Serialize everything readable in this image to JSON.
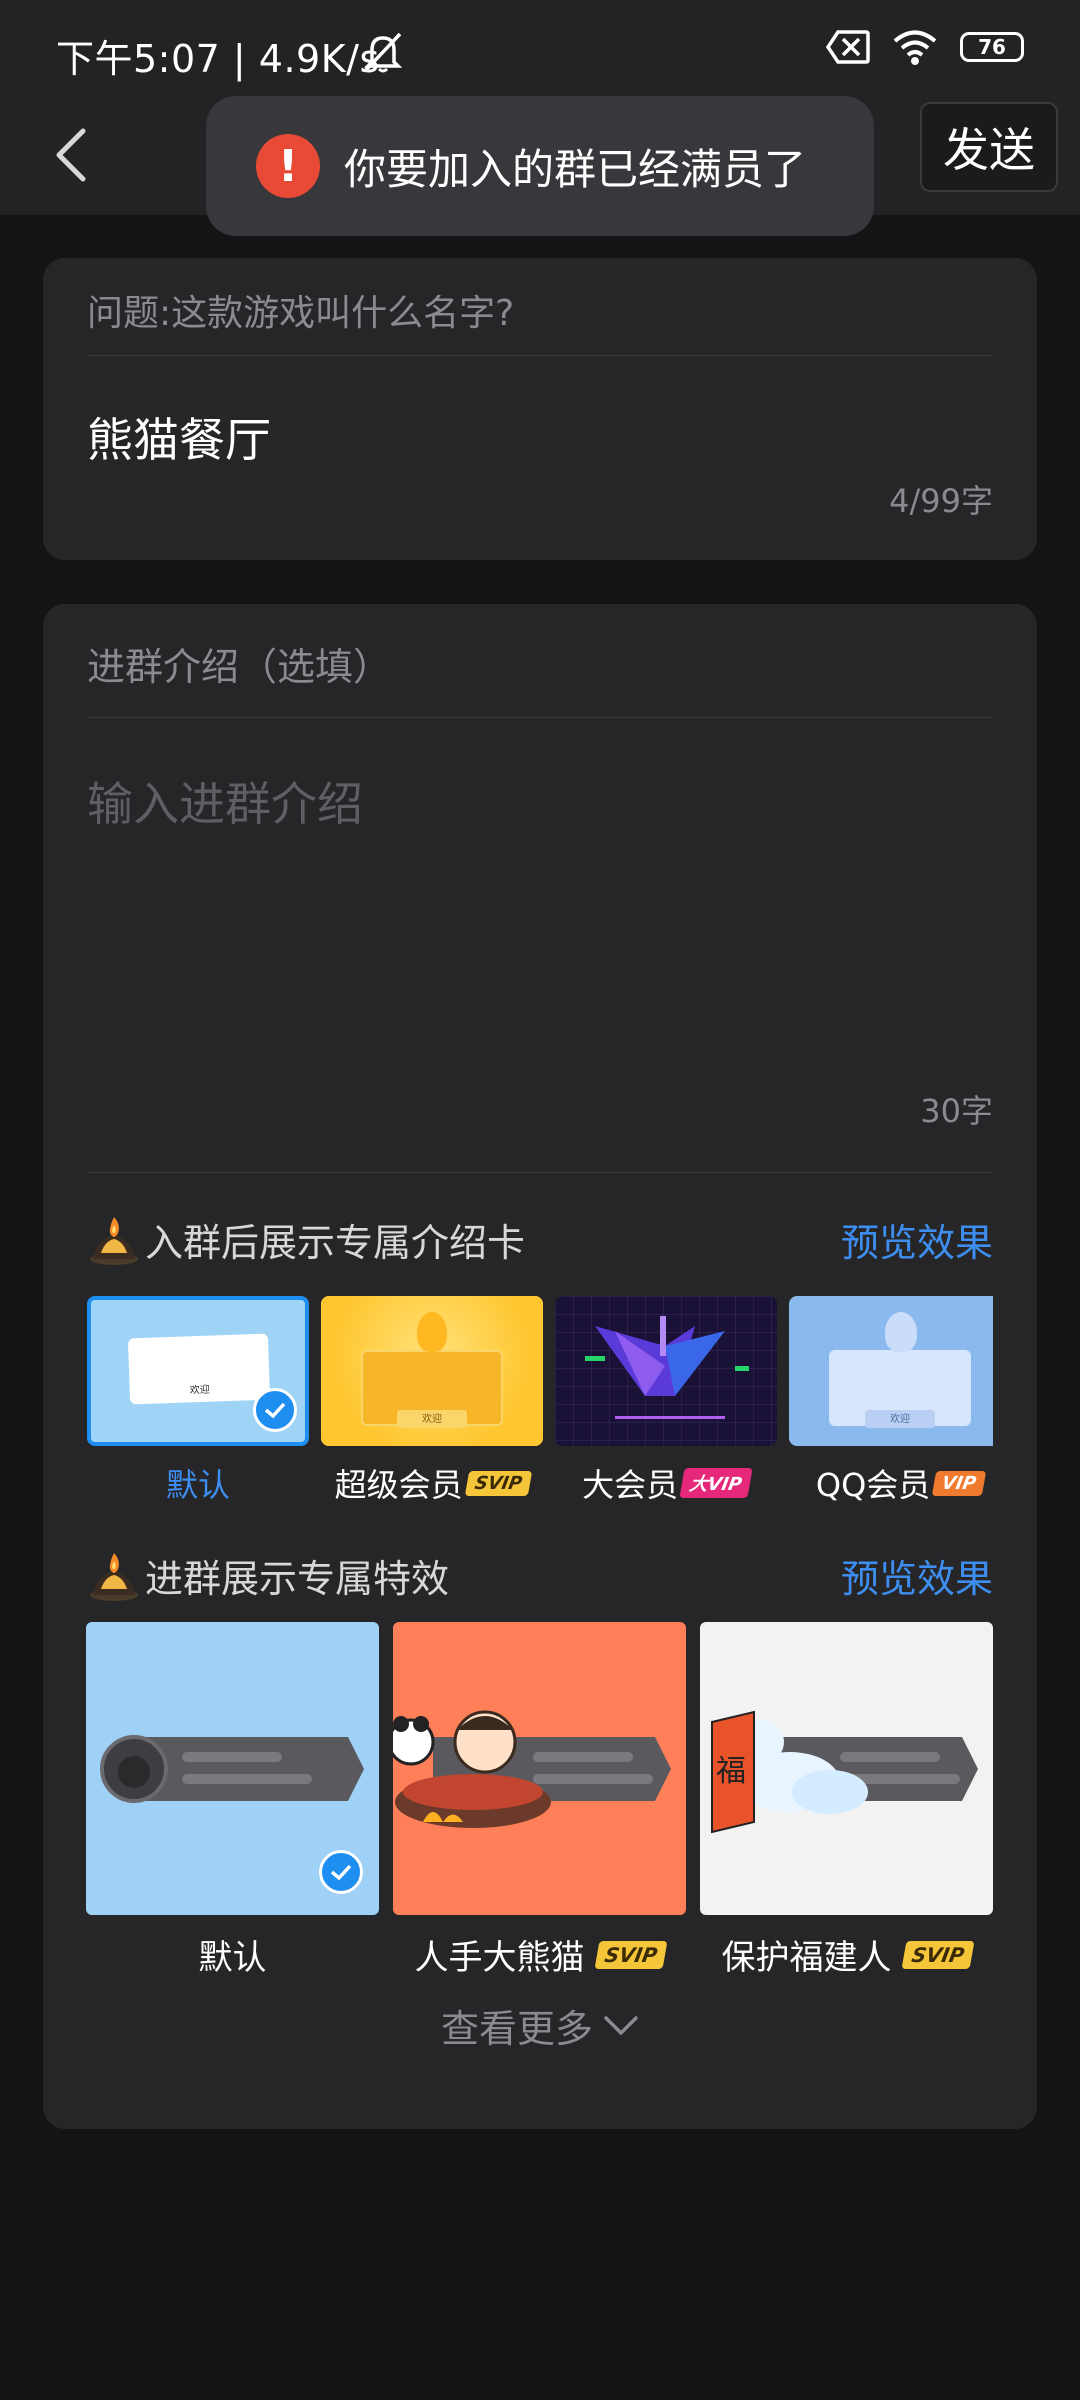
{
  "status_bar": {
    "time_speed": "下午5:07 | 4.9K/s",
    "battery": "76",
    "icons": [
      "mute-bell-icon",
      "sim-disabled-icon",
      "wifi-icon",
      "battery-icon"
    ]
  },
  "nav": {
    "back_icon": "back-chevron-icon",
    "send_label": "发送"
  },
  "toast": {
    "icon": "!",
    "text": "你要加入的群已经满员了"
  },
  "question": {
    "label": "问题:这款游戏叫什么名字?",
    "answer": "熊猫餐厅",
    "count": "4/99字"
  },
  "intro": {
    "label": "进群介绍（选填）",
    "placeholder": "输入进群介绍",
    "count": "30字"
  },
  "intro_cards": {
    "title": "入群后展示专属介绍卡",
    "preview": "预览效果",
    "items": [
      {
        "label": "默认",
        "badge": "",
        "selected": true,
        "preview_text": "欢迎"
      },
      {
        "label": "超级会员",
        "badge": "SVIP",
        "preview_text": "欢迎"
      },
      {
        "label": "大会员",
        "badge": "大VIP"
      },
      {
        "label": "QQ会员",
        "badge": "VIP",
        "preview_text": "欢迎"
      }
    ]
  },
  "effects": {
    "title": "进群展示专属特效",
    "preview": "预览效果",
    "items": [
      {
        "label": "默认",
        "badge": "",
        "selected": true
      },
      {
        "label": "人手大熊猫",
        "badge": "SVIP"
      },
      {
        "label": "保护福建人",
        "badge": "SVIP",
        "glyph": "福"
      }
    ],
    "more": "查看更多"
  },
  "colors": {
    "accent": "#3d8ef0",
    "toast_error": "#e84a36",
    "svip_badge": "#f5c53a",
    "bigvip_badge": "#e6287a",
    "vip_badge": "#f07a2e"
  }
}
